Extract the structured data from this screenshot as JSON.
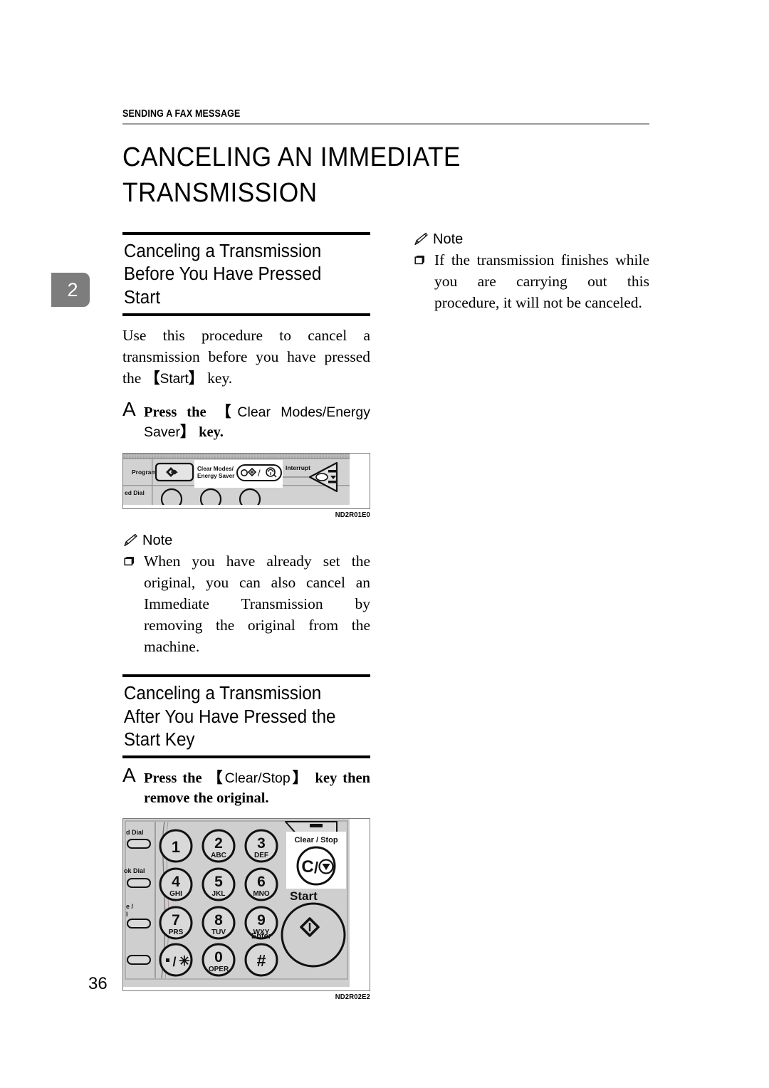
{
  "page": {
    "running_header": "SENDING A FAX MESSAGE",
    "chapter_tab": "2",
    "page_number": "36",
    "chapter_title": "CANCELING AN IMMEDIATE TRANSMISSION"
  },
  "left_column": {
    "section1": {
      "title": "Canceling a Transmission\nBefore You Have Pressed Start",
      "intro_before": "Use this procedure to cancel a transmission before you have pressed the ",
      "intro_key": "Start",
      "intro_after": " key.",
      "step_marker": "A",
      "step_text_before": "Press the ",
      "step_key": "Clear Modes/Energy Saver",
      "step_text_after": " key.",
      "figure": {
        "code": "ND2R01E0",
        "labels": {
          "program": "Program",
          "clear_modes": "Clear Modes/",
          "energy_saver": "Energy Saver",
          "interrupt": "Interrupt",
          "speed_dial": "ed Dial"
        }
      },
      "note": {
        "heading": "Note",
        "items": [
          "When you have already set the original, you can also cancel an Immediate Transmission by removing the original from the machine."
        ]
      }
    },
    "section2": {
      "title": "Canceling a Transmission\nAfter You Have Pressed the\nStart Key",
      "step_marker": "A",
      "step_text_before": "Press the ",
      "step_key": "Clear/Stop",
      "step_text_after": " key then remove the original.",
      "figure": {
        "code": "ND2R02E2",
        "side_labels": [
          "d Dial",
          "ok Dial",
          "e /",
          "l"
        ],
        "clear_stop_label": "Clear / Stop",
        "clear_stop_glyph": "C/",
        "start_label": "Start",
        "enter_label": "Enter",
        "keys": [
          {
            "digit": "1",
            "letters": ""
          },
          {
            "digit": "2",
            "letters": "ABC"
          },
          {
            "digit": "3",
            "letters": "DEF"
          },
          {
            "digit": "4",
            "letters": "GHI"
          },
          {
            "digit": "5",
            "letters": "JKL"
          },
          {
            "digit": "6",
            "letters": "MNO"
          },
          {
            "digit": "7",
            "letters": "PRS"
          },
          {
            "digit": "8",
            "letters": "TUV"
          },
          {
            "digit": "9",
            "letters": "WXY"
          },
          {
            "digit": "*",
            "letters": ""
          },
          {
            "digit": "0",
            "letters": "OPER"
          },
          {
            "digit": "#",
            "letters": ""
          }
        ]
      }
    }
  },
  "right_column": {
    "note": {
      "heading": "Note",
      "items": [
        "If the transmission finishes while you are carrying out this procedure, it will not be canceled."
      ]
    }
  }
}
